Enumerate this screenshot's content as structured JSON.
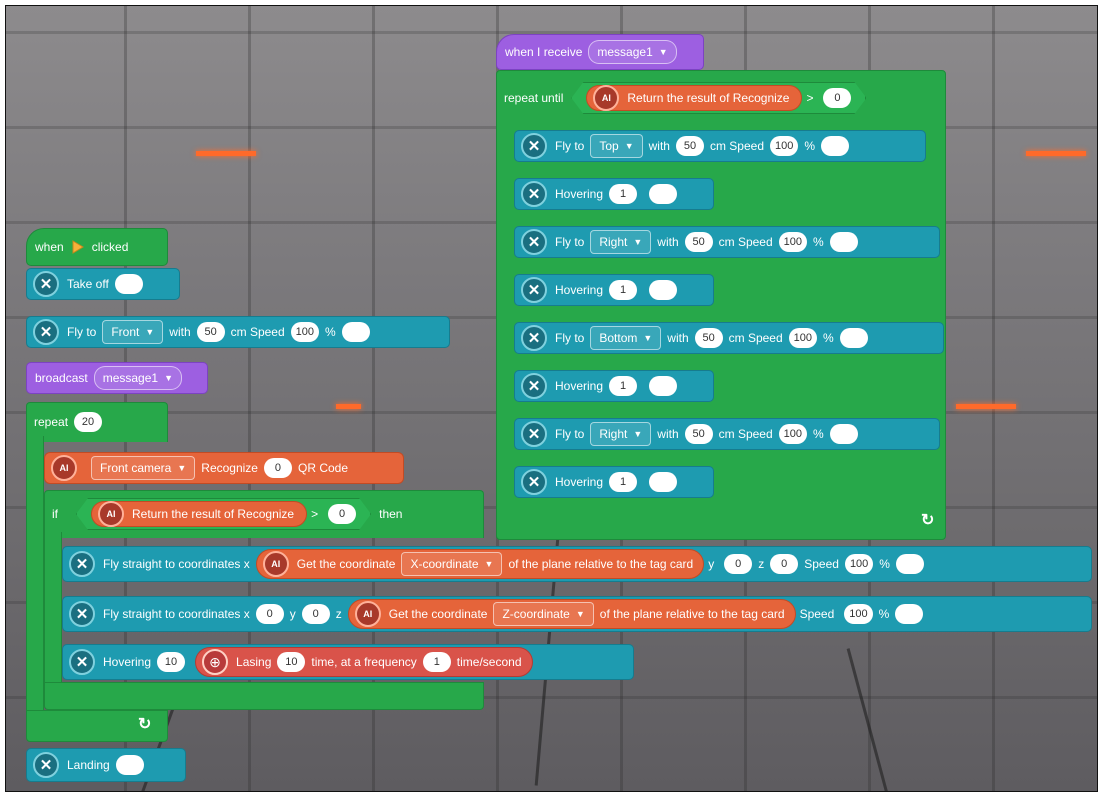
{
  "script_left": {
    "hat": {
      "prefix": "when",
      "suffix": "clicked"
    },
    "take_off": {
      "label": "Take off"
    },
    "fly_to": {
      "label": "Fly to",
      "direction": "Front",
      "with": "with",
      "distance": "50",
      "cm_speed": "cm Speed",
      "speed": "100",
      "percent": "%"
    },
    "broadcast": {
      "label": "broadcast",
      "message": "message1"
    },
    "repeat": {
      "label": "repeat",
      "count": "20"
    },
    "recognize": {
      "ai": "AI",
      "camera": "Front camera",
      "label": "Recognize",
      "value": "0",
      "target": "QR Code"
    },
    "if_block": {
      "if": "if",
      "ai": "AI",
      "label": "Return the result of Recognize",
      "op": ">",
      "value": "0",
      "then": "then"
    },
    "fly_straight_1": {
      "label": "Fly straight to coordinates x",
      "ai": "AI",
      "get": "Get the coordinate",
      "coord": "X-coordinate",
      "rel": "of the plane relative to the tag card",
      "y": "y",
      "y_val": "0",
      "z": "z",
      "z_val": "0",
      "speed_label": "Speed",
      "speed": "100",
      "percent": "%"
    },
    "fly_straight_2": {
      "label": "Fly straight to coordinates x",
      "x_val": "0",
      "y": "y",
      "y_val": "0",
      "z": "z",
      "ai": "AI",
      "get": "Get the coordinate",
      "coord": "Z-coordinate",
      "rel": "of the plane relative to the tag card",
      "speed_label": "Speed",
      "speed": "100",
      "percent": "%"
    },
    "hovering": {
      "label": "Hovering",
      "value": "10",
      "lasing": "Lasing",
      "times": "10",
      "freq_text": "time, at a frequency",
      "freq": "1",
      "unit": "time/second"
    },
    "landing": {
      "label": "Landing"
    }
  },
  "script_right": {
    "hat": {
      "label": "when I receive",
      "message": "message1"
    },
    "repeat_until": {
      "label": "repeat until",
      "ai": "AI",
      "cond": "Return the result of Recognize",
      "op": ">",
      "value": "0"
    },
    "fly_1": {
      "label": "Fly to",
      "direction": "Top",
      "with": "with",
      "distance": "50",
      "cm_speed": "cm Speed",
      "speed": "100",
      "percent": "%"
    },
    "hover_1": {
      "label": "Hovering",
      "value": "1"
    },
    "fly_2": {
      "label": "Fly to",
      "direction": "Right",
      "with": "with",
      "distance": "50",
      "cm_speed": "cm Speed",
      "speed": "100",
      "percent": "%"
    },
    "hover_2": {
      "label": "Hovering",
      "value": "1"
    },
    "fly_3": {
      "label": "Fly to",
      "direction": "Bottom",
      "with": "with",
      "distance": "50",
      "cm_speed": "cm Speed",
      "speed": "100",
      "percent": "%"
    },
    "hover_3": {
      "label": "Hovering",
      "value": "1"
    },
    "fly_4": {
      "label": "Fly to",
      "direction": "Right",
      "with": "with",
      "distance": "50",
      "cm_speed": "cm Speed",
      "speed": "100",
      "percent": "%"
    },
    "hover_4": {
      "label": "Hovering",
      "value": "1"
    }
  },
  "icons": {
    "drone": "drone-icon",
    "ai": "ai-icon",
    "laser": "laser-icon",
    "flag": "green-flag-icon",
    "loop": "loop-arrow-icon"
  },
  "colors": {
    "motion": "#1e9bb0",
    "events": "#9d5fe1",
    "control": "#27a84a",
    "ai": "#e5643a"
  }
}
